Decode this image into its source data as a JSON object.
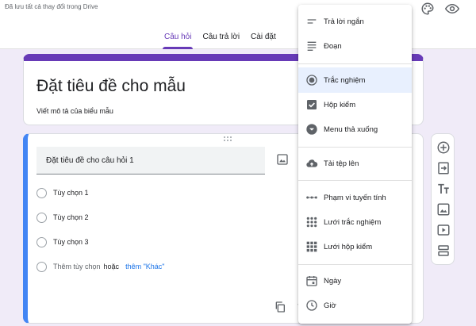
{
  "header": {
    "saved_status": "Đã lưu tất cả thay đổi trong Drive",
    "tabs": [
      {
        "label": "Câu hỏi",
        "active": true
      },
      {
        "label": "Câu trả lời",
        "active": false
      },
      {
        "label": "Cài đặt",
        "active": false
      }
    ],
    "icons": [
      "palette-icon",
      "eye-icon"
    ]
  },
  "form": {
    "title": "Đặt tiêu đề cho mẫu",
    "description": "Viết mô tả của biểu mẫu"
  },
  "question": {
    "title": "Đặt tiêu đề cho câu hỏi 1",
    "options": [
      "Tùy chọn 1",
      "Tùy chọn 2",
      "Tùy chọn 3"
    ],
    "add_option": "Thêm tùy chọn",
    "or_text": "hoặc",
    "add_other": "thêm \"Khác\""
  },
  "question_types": {
    "groups": [
      [
        {
          "label": "Trả lời ngắn",
          "icon": "short-answer-icon"
        },
        {
          "label": "Đoạn",
          "icon": "paragraph-icon"
        }
      ],
      [
        {
          "label": "Trắc nghiệm",
          "icon": "radio-icon",
          "selected": true
        },
        {
          "label": "Hộp kiểm",
          "icon": "checkbox-icon"
        },
        {
          "label": "Menu thả xuống",
          "icon": "dropdown-icon"
        }
      ],
      [
        {
          "label": "Tải tệp lên",
          "icon": "cloud-upload-icon"
        }
      ],
      [
        {
          "label": "Phạm vi tuyến tính",
          "icon": "linear-scale-icon"
        },
        {
          "label": "Lưới trắc nghiệm",
          "icon": "grid-dots-icon"
        },
        {
          "label": "Lưới hộp kiểm",
          "icon": "grid-squares-icon"
        }
      ],
      [
        {
          "label": "Ngày",
          "icon": "calendar-icon"
        },
        {
          "label": "Giờ",
          "icon": "clock-icon"
        }
      ]
    ]
  },
  "side_toolbar": [
    "add-question-icon",
    "import-question-icon",
    "add-title-icon",
    "add-image-icon",
    "add-video-icon",
    "add-section-icon"
  ],
  "colors": {
    "accent": "#673ab7",
    "active_question": "#4285f4",
    "link": "#1a73e8",
    "background": "#f0ebf8",
    "selected_item": "#e8f0fe"
  }
}
